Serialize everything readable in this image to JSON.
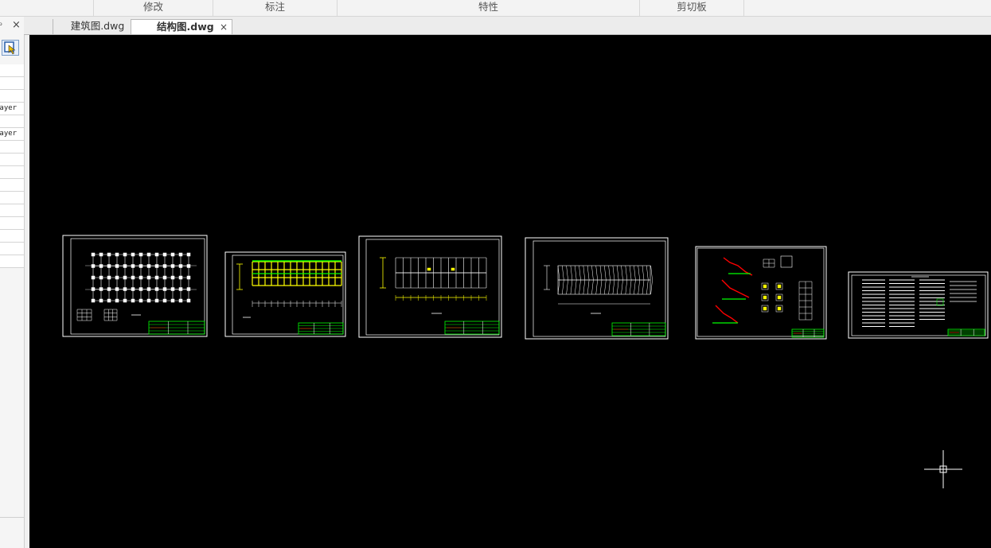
{
  "ribbon": {
    "groups": [
      {
        "label": ""
      },
      {
        "label": "修改"
      },
      {
        "label": "标注"
      },
      {
        "label": "特性"
      },
      {
        "label": "剪切板"
      }
    ]
  },
  "tabs": [
    {
      "label": "建筑图.dwg",
      "active": false
    },
    {
      "label": "结构图.dwg",
      "active": true,
      "close": "×"
    }
  ],
  "left_panel": {
    "pin_glyph": "ᵖ",
    "close_glyph": "×",
    "rows": [
      "",
      "",
      "",
      "Layer",
      "",
      "Layer",
      "",
      "",
      "",
      "",
      "",
      "",
      "",
      "",
      "",
      ""
    ]
  },
  "colors": {
    "canvas_bg": "#000000",
    "line_white": "#ffffff",
    "line_yellow": "#ffff00",
    "line_green": "#00ff00",
    "line_red": "#ff0000",
    "crosshair": "#ffffff"
  },
  "sheets": [
    {
      "name": "sheet-foundation-plan"
    },
    {
      "name": "sheet-beam-layout-yellow"
    },
    {
      "name": "sheet-floor-plan"
    },
    {
      "name": "sheet-column-elevation"
    },
    {
      "name": "sheet-stair-details"
    },
    {
      "name": "sheet-design-notes"
    }
  ]
}
